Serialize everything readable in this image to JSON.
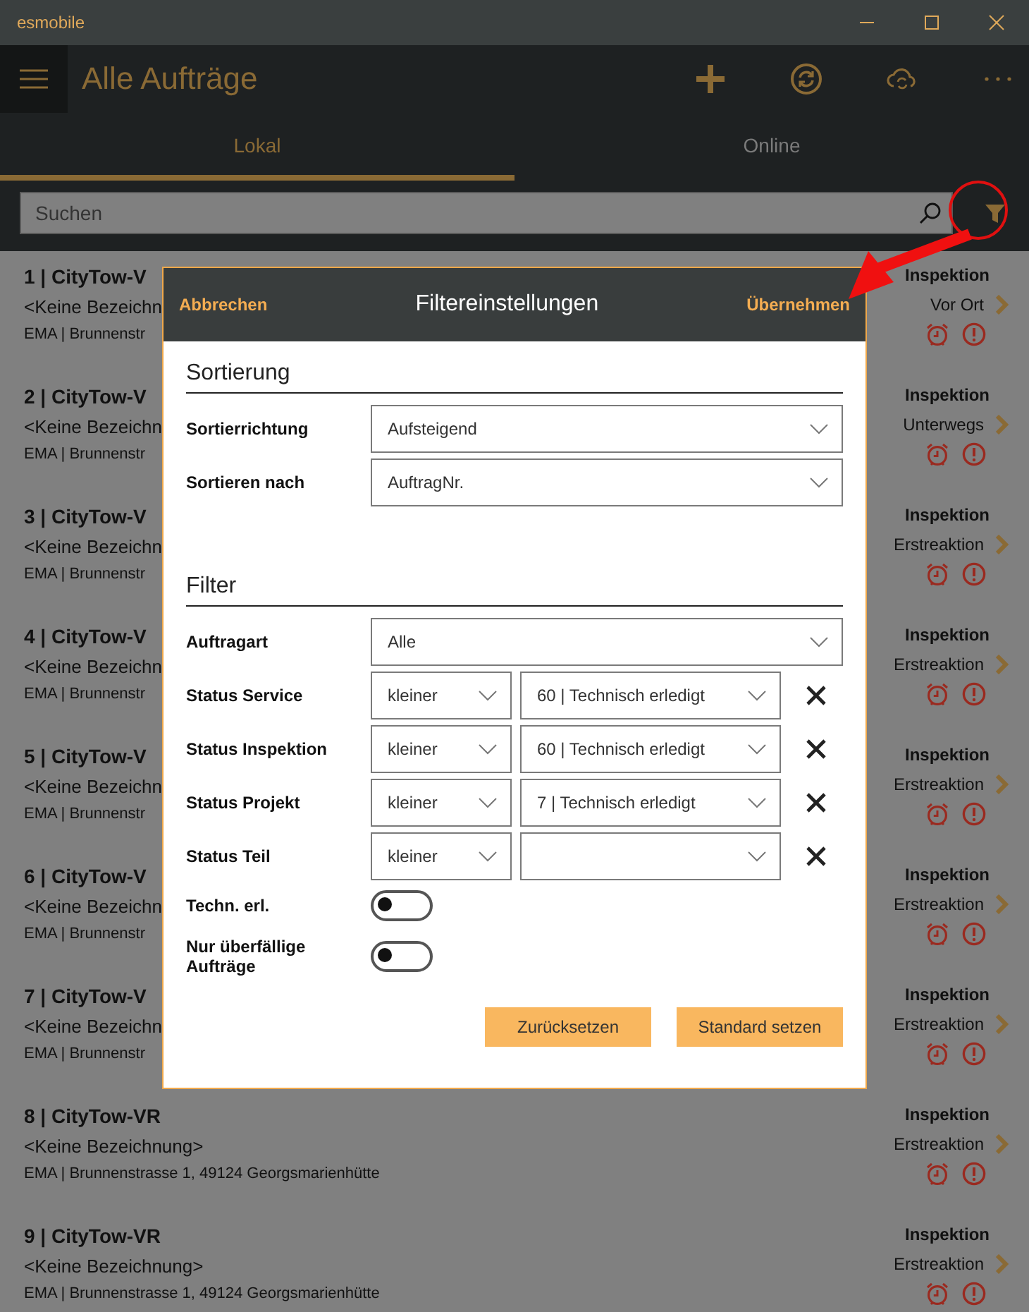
{
  "window": {
    "title": "esmobile"
  },
  "app_bar": {
    "title": "Alle Aufträge"
  },
  "tabs": [
    {
      "label": "Lokal",
      "selected": true
    },
    {
      "label": "Online",
      "selected": false
    }
  ],
  "search": {
    "placeholder": "Suchen"
  },
  "orders": [
    {
      "title": "1  |  CityTow-V",
      "description": "<Keine Bezeichn",
      "address": "EMA  |  Brunnenstr",
      "type": "Inspektion",
      "status": "Vor Ort"
    },
    {
      "title": "2  |  CityTow-V",
      "description": "<Keine Bezeichn",
      "address": "EMA  |  Brunnenstr",
      "type": "Inspektion",
      "status": "Unterwegs"
    },
    {
      "title": "3  |  CityTow-V",
      "description": "<Keine Bezeichn",
      "address": "EMA  |  Brunnenstr",
      "type": "Inspektion",
      "status": "Erstreaktion"
    },
    {
      "title": "4  |  CityTow-V",
      "description": "<Keine Bezeichn",
      "address": "EMA  |  Brunnenstr",
      "type": "Inspektion",
      "status": "Erstreaktion"
    },
    {
      "title": "5  |  CityTow-V",
      "description": "<Keine Bezeichn",
      "address": "EMA  |  Brunnenstr",
      "type": "Inspektion",
      "status": "Erstreaktion"
    },
    {
      "title": "6  |  CityTow-V",
      "description": "<Keine Bezeichn",
      "address": "EMA  |  Brunnenstr",
      "type": "Inspektion",
      "status": "Erstreaktion"
    },
    {
      "title": "7  |  CityTow-V",
      "description": "<Keine Bezeichn",
      "address": "EMA  |  Brunnenstr",
      "type": "Inspektion",
      "status": "Erstreaktion"
    },
    {
      "title": "8  |  CityTow-VR",
      "description": "<Keine Bezeichnung>",
      "address": "EMA  |  Brunnenstrasse 1, 49124 Georgsmarienhütte",
      "type": "Inspektion",
      "status": "Erstreaktion"
    },
    {
      "title": "9  |  CityTow-VR",
      "description": "<Keine Bezeichnung>",
      "address": "EMA  |  Brunnenstrasse 1, 49124 Georgsmarienhütte",
      "type": "Inspektion",
      "status": "Erstreaktion"
    }
  ],
  "dialog": {
    "cancel": "Abbrechen",
    "title": "Filtereinstellungen",
    "apply": "Übernehmen",
    "sections": [
      {
        "heading": "Sortierung",
        "rows": [
          {
            "kind": "select",
            "label": "Sortierrichtung",
            "value": "Aufsteigend"
          },
          {
            "kind": "select",
            "label": "Sortieren nach",
            "value": "AuftragNr."
          }
        ]
      },
      {
        "heading": "Filter",
        "rows": [
          {
            "kind": "select",
            "label": "Auftragart",
            "value": "Alle"
          },
          {
            "kind": "status",
            "label": "Status Service",
            "operator": "kleiner",
            "value": "60  |  Technisch erledigt"
          },
          {
            "kind": "status",
            "label": "Status Inspektion",
            "operator": "kleiner",
            "value": "60  |  Technisch erledigt"
          },
          {
            "kind": "status",
            "label": "Status Projekt",
            "operator": "kleiner",
            "value": "7  |  Technisch erledigt"
          },
          {
            "kind": "status",
            "label": "Status Teil",
            "operator": "kleiner"
          },
          {
            "kind": "toggle",
            "label": "Techn. erl.",
            "on": false
          },
          {
            "kind": "toggle",
            "label": "Nur überfällige Aufträge",
            "on": false
          }
        ]
      }
    ],
    "buttons": [
      "Zurücksetzen",
      "Standard setzen"
    ]
  }
}
